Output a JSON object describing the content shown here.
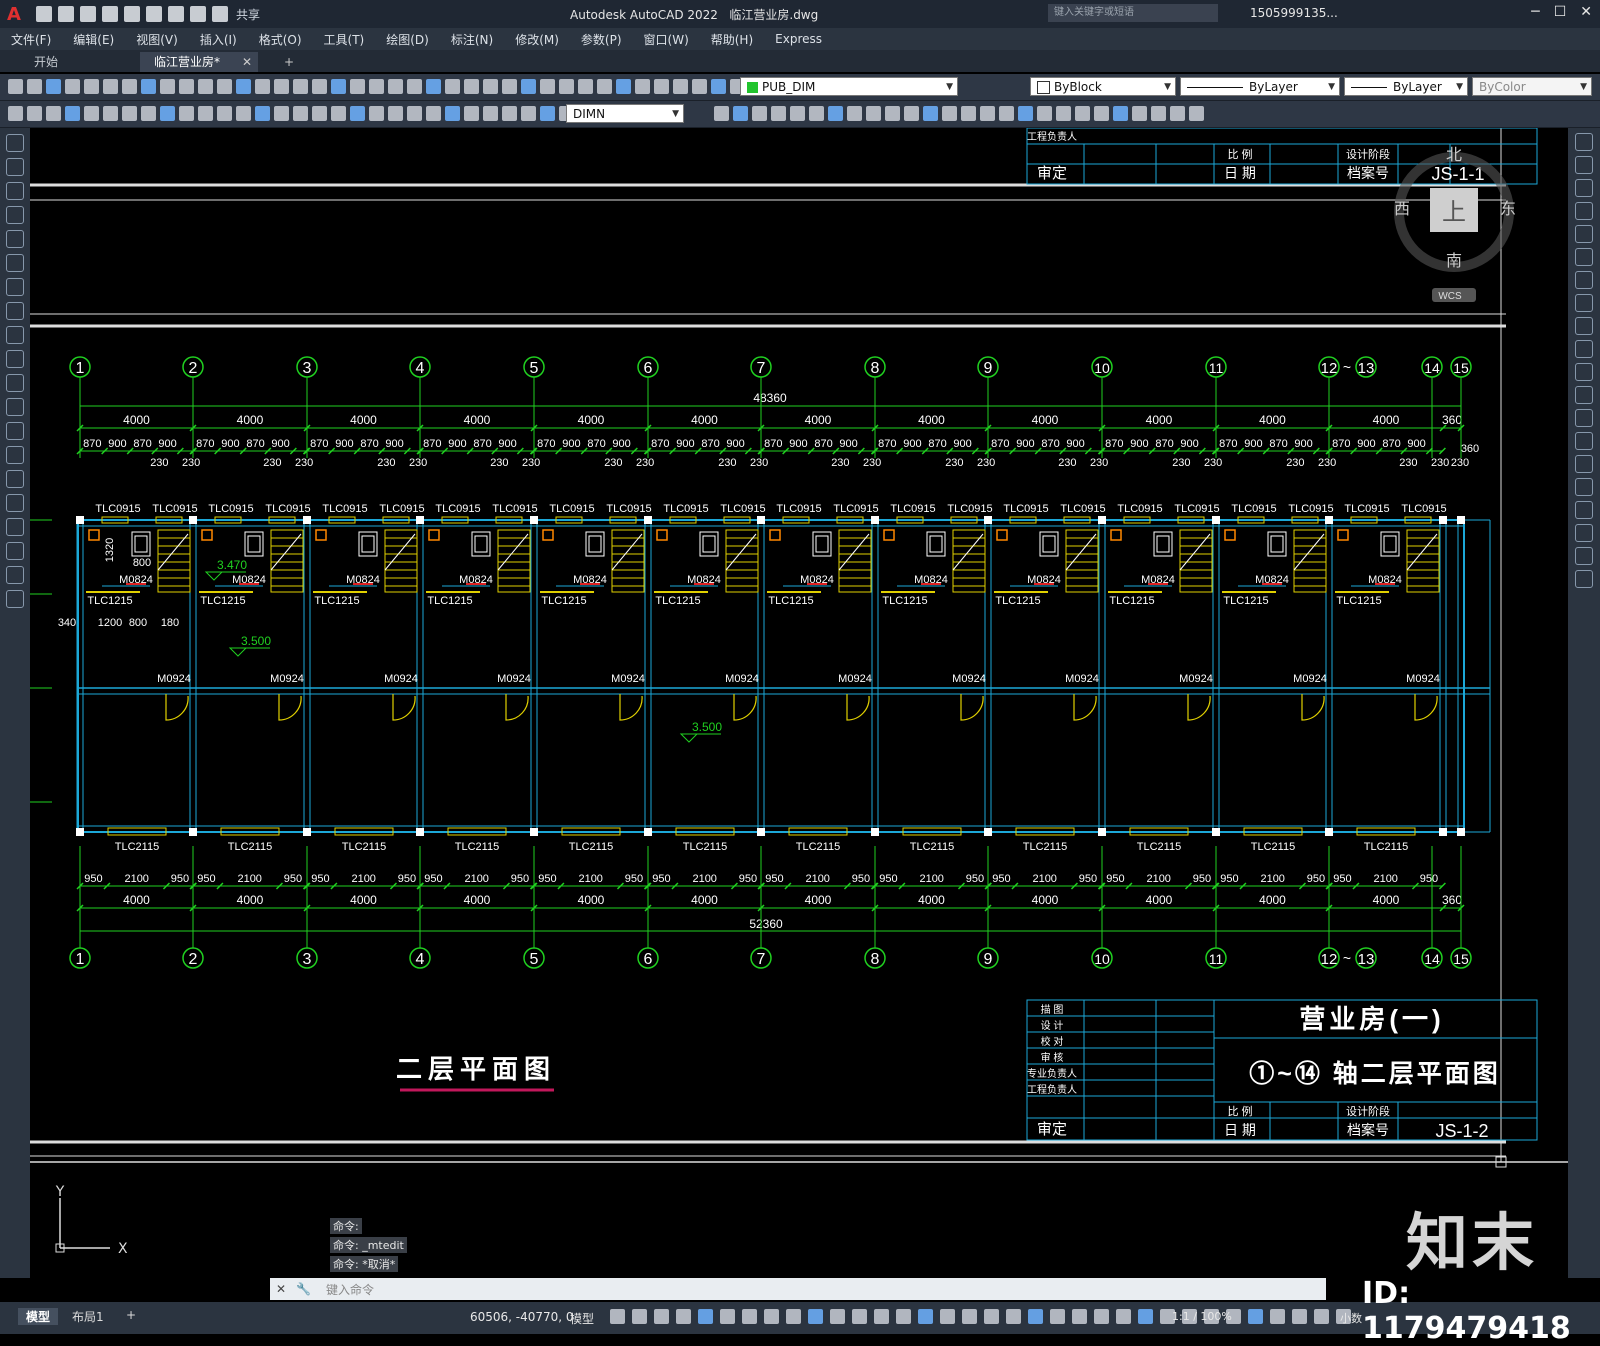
{
  "window": {
    "app_title": "Autodesk AutoCAD 2022",
    "file_name": "临江营业房.dwg",
    "share_label": "共享",
    "search_placeholder": "键入关键字或短语",
    "user": "1505999135...",
    "logo": "A"
  },
  "menu": [
    "文件(F)",
    "编辑(E)",
    "视图(V)",
    "插入(I)",
    "格式(O)",
    "工具(T)",
    "绘图(D)",
    "标注(N)",
    "修改(M)",
    "参数(P)",
    "窗口(W)",
    "帮助(H)",
    "Express"
  ],
  "tabs": {
    "start": "开始",
    "doc": "临江营业房*",
    "plus": "+"
  },
  "toolbar": {
    "layer": "PUB_DIM",
    "color": "ByBlock",
    "linetype": "ByLayer",
    "lineweight": "ByLayer",
    "plotstyle": "ByColor",
    "dimstyle": "DIMN"
  },
  "viewcube": {
    "north": "北",
    "south": "南",
    "east": "东",
    "west": "西",
    "top": "上",
    "wcs": "WCS"
  },
  "drawing": {
    "axes_top": [
      "1",
      "2",
      "3",
      "4",
      "5",
      "6",
      "7",
      "8",
      "9",
      "10",
      "11",
      "12~13",
      "14",
      "15"
    ],
    "axes_bottom": [
      "1",
      "2",
      "3",
      "4",
      "5",
      "6",
      "7",
      "8",
      "9",
      "10",
      "11",
      "12~13",
      "14",
      "15"
    ],
    "total_top": "48360",
    "total_bottom": "52360",
    "bay": "4000",
    "end_dim": "360",
    "top_segments": [
      "870",
      "900",
      "870",
      "900"
    ],
    "wall_230": "230",
    "bottom_segments": [
      "950",
      "2100",
      "950"
    ],
    "window_top": "TLC0915",
    "window_mid": "TLC1215",
    "door_small": "M0824",
    "door_main": "M0924",
    "window_bottom": "TLC2115",
    "elev_1": "3.470",
    "elev_2": "3.500",
    "elev_3": "3.500",
    "dims_local": [
      "1320",
      "800",
      "340",
      "1200",
      "800",
      "180"
    ],
    "plan_title": "二层平面图",
    "upper_block": {
      "ref": "JS-1-1",
      "rows": [
        "工程负责人",
        "审定"
      ],
      "labels": [
        "比 例",
        "设计阶段",
        "日 期",
        "档案号"
      ]
    },
    "title_block": {
      "project": "营业房(一)",
      "drawing_name": "①~⑭ 轴二层平面图",
      "rows": [
        "描 图",
        "设 计",
        "校 对",
        "审 核",
        "专业负责人",
        "工程负责人",
        "审定"
      ],
      "labels": [
        "比 例",
        "设计阶段",
        "日 期",
        "档案号"
      ],
      "ref": "JS-1-2"
    }
  },
  "command": {
    "history": [
      "命令:",
      "命令: _mtedit",
      "命令: *取消*"
    ],
    "prompt": "键入命令"
  },
  "status": {
    "model_tab": "模型",
    "layout_tab": "布局1",
    "plus": "+",
    "coords": "60506, -40770, 0",
    "model": "模型",
    "scale": "1:1 / 100%",
    "units": "小数"
  },
  "watermark": {
    "brand": "知末",
    "id": "ID: 1179479418"
  }
}
